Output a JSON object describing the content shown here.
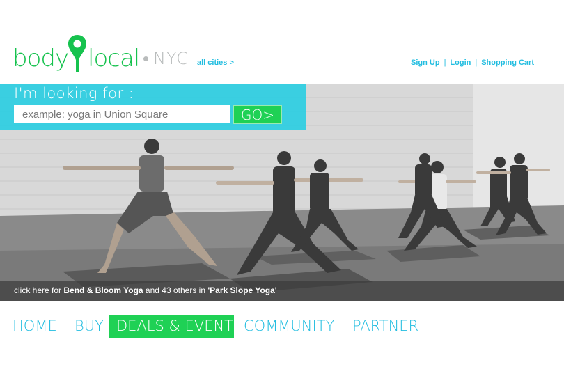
{
  "brand": {
    "name_part1": "body",
    "name_part2": "local",
    "city": "NYC",
    "primary_color": "#16c24e",
    "accent_color": "#22bde0"
  },
  "header": {
    "all_cities_link": "all cities >",
    "links": [
      "Sign Up",
      "Login",
      "Shopping Cart"
    ]
  },
  "search": {
    "heading": "I'm looking for :",
    "placeholder": "example: yoga in Union Square",
    "go_label": "GO>"
  },
  "hero": {
    "caption_prefix": "click here for ",
    "caption_studio": "Bend & Bloom Yoga",
    "caption_middle": " and 43 others in ",
    "caption_category": "'Park Slope Yoga'"
  },
  "nav": {
    "items": [
      "HOME",
      "BUY",
      "DEALS & EVENTS",
      "COMMUNITY",
      "PARTNER"
    ],
    "active": "DEALS & EVENTS"
  }
}
